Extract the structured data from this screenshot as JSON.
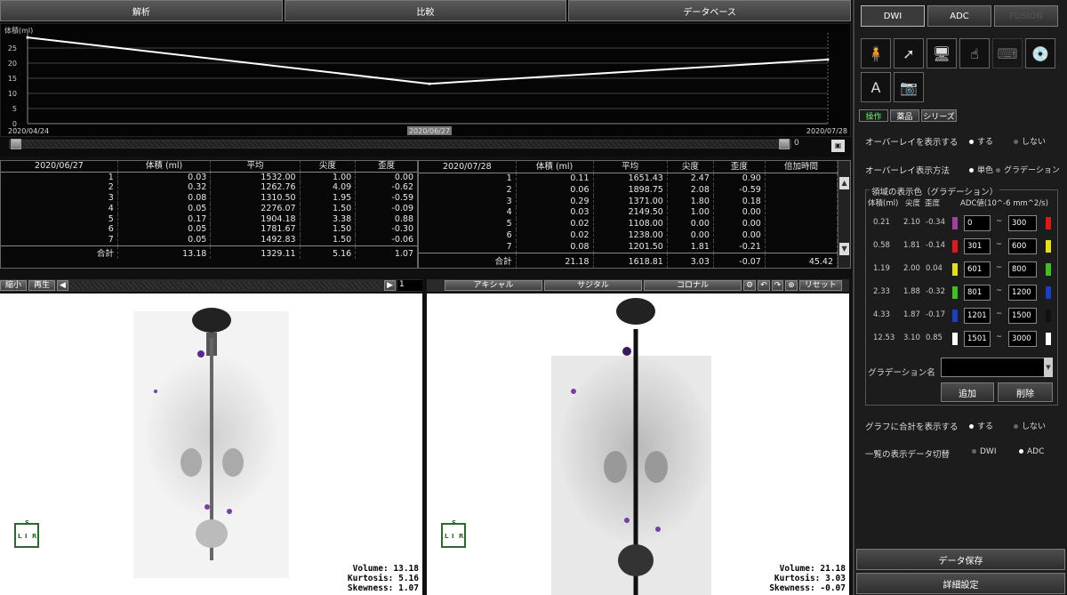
{
  "tabs": [
    "解析",
    "比較",
    "データベース"
  ],
  "chart": {
    "ylabel": "体積(ml)",
    "yticks": [
      "25",
      "20",
      "15",
      "10",
      "5",
      "0"
    ],
    "xlabels": [
      "2020/04/24",
      "2020/06/27",
      "2020/07/28"
    ],
    "values": [
      28.5,
      13.18,
      21.18
    ],
    "ymax": 30,
    "range_value": "0",
    "line_color": "#ffffff"
  },
  "table_left": {
    "headers": [
      "2020/06/27",
      "体積 (ml)",
      "平均",
      "尖度",
      "歪度"
    ],
    "rows": [
      [
        "1",
        "0.03",
        "1532.00",
        "1.00",
        "0.00"
      ],
      [
        "2",
        "0.32",
        "1262.76",
        "4.09",
        "-0.62"
      ],
      [
        "3",
        "0.08",
        "1310.50",
        "1.95",
        "-0.59"
      ],
      [
        "4",
        "0.05",
        "2276.07",
        "1.50",
        "-0.09"
      ],
      [
        "5",
        "0.17",
        "1904.18",
        "3.38",
        "0.88"
      ],
      [
        "6",
        "0.05",
        "1781.67",
        "1.50",
        "-0.30"
      ],
      [
        "7",
        "0.05",
        "1492.83",
        "1.50",
        "-0.06"
      ]
    ],
    "total": [
      "合計",
      "13.18",
      "1329.11",
      "5.16",
      "1.07"
    ]
  },
  "table_right": {
    "headers": [
      "2020/07/28",
      "体積 (ml)",
      "平均",
      "尖度",
      "歪度",
      "倍加時間"
    ],
    "rows": [
      [
        "1",
        "0.11",
        "1651.43",
        "2.47",
        "0.90",
        ""
      ],
      [
        "2",
        "0.06",
        "1898.75",
        "2.08",
        "-0.59",
        ""
      ],
      [
        "3",
        "0.29",
        "1371.00",
        "1.80",
        "0.18",
        ""
      ],
      [
        "4",
        "0.03",
        "2149.50",
        "1.00",
        "0.00",
        ""
      ],
      [
        "5",
        "0.02",
        "1108.00",
        "0.00",
        "0.00",
        ""
      ],
      [
        "6",
        "0.02",
        "1238.00",
        "0.00",
        "0.00",
        ""
      ],
      [
        "7",
        "0.08",
        "1201.50",
        "1.81",
        "-0.21",
        ""
      ]
    ],
    "total": [
      "合計",
      "21.18",
      "1618.81",
      "3.03",
      "-0.07",
      "45.42"
    ]
  },
  "left_viewer": {
    "btn_collapse": "縮小",
    "btn_play": "再生",
    "frame": "1",
    "stats": [
      "Volume: 13.18",
      "Kurtosis: 5.16",
      "Skewness: 1.07"
    ]
  },
  "right_viewer": {
    "views": [
      "アキシャル",
      "サジタル",
      "コロナル"
    ],
    "reset": "リセット",
    "stats": [
      "Volume: 21.18",
      "Kurtosis: 3.03",
      "Skewness: -0.07"
    ]
  },
  "orient": {
    "top": "S",
    "left": "R",
    "right": "L",
    "bottom": "I"
  },
  "side": {
    "modes": [
      "DWI",
      "ADC",
      "FUSION"
    ],
    "subtabs": [
      "操作",
      "薬品",
      "シリーズ"
    ],
    "overlay_label": "オーバーレイを表示する",
    "overlay_opts": [
      "する",
      "しない"
    ],
    "method_label": "オーバーレイ表示方法",
    "method_opts": [
      "単色",
      "グラデーション"
    ],
    "grad_title": "領域の表示色（グラデーション）",
    "grad_headers": [
      "体積(ml)",
      "尖度",
      "歪度",
      "ADC値(10^-6 mm^2/s)"
    ],
    "grad_rows": [
      {
        "v": "0.21",
        "k": "2.10",
        "s": "-0.34",
        "c1": "#a040a0",
        "from": "0",
        "to": "300",
        "c2": "#e01818"
      },
      {
        "v": "0.58",
        "k": "1.81",
        "s": "-0.14",
        "c1": "#e01818",
        "from": "301",
        "to": "600",
        "c2": "#e8e010"
      },
      {
        "v": "1.19",
        "k": "2.00",
        "s": "0.04",
        "c1": "#e8e010",
        "from": "601",
        "to": "800",
        "c2": "#40c020"
      },
      {
        "v": "2.33",
        "k": "1.88",
        "s": "-0.32",
        "c1": "#40c020",
        "from": "801",
        "to": "1200",
        "c2": "#1a40c0"
      },
      {
        "v": "4.33",
        "k": "1.87",
        "s": "-0.17",
        "c1": "#1a40c0",
        "from": "1201",
        "to": "1500",
        "c2": "#111111"
      },
      {
        "v": "12.53",
        "k": "3.10",
        "s": "0.85",
        "c1": "#ffffff",
        "from": "1501",
        "to": "3000",
        "c2": "#ffffff"
      }
    ],
    "grad_name_label": "グラデーション名",
    "add": "追加",
    "del": "削除",
    "graph_label": "グラフに合計を表示する",
    "graph_opts": [
      "する",
      "しない"
    ],
    "list_label": "一覧の表示データ切替",
    "list_opts": [
      "DWI",
      "ADC"
    ],
    "save": "データ保存",
    "settings": "詳細設定",
    "icons": [
      "person-icon",
      "cursor-icon",
      "monitor-icon",
      "hand-select-icon",
      "keyboard-icon",
      "cd-icon",
      "text-arrow-icon",
      "camera-icon"
    ]
  }
}
